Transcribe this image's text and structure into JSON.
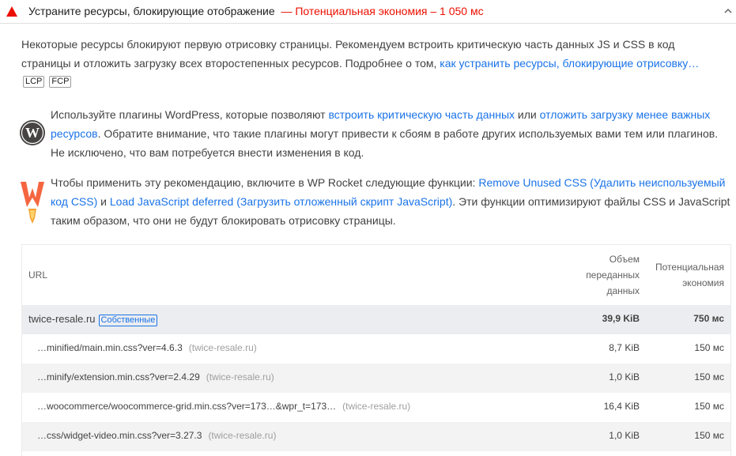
{
  "audit": {
    "title": "Устраните ресурсы, блокирующие отображение",
    "savings": "— Потенциальная экономия – 1 050 мс",
    "icon_warn": "warning-triangle-icon",
    "icon_toggle": "chevron-up-icon",
    "warn_color": "#eb0f00"
  },
  "description": {
    "text": "Некоторые ресурсы блокируют первую отрисовку страницы. Рекомендуем встроить критическую часть данных JS и CSS в код страницы и отложить загрузку всех второстепенных ресурсов. Подробнее о том, ",
    "link": "как устранить ресурсы, блокирующие отрисовку…",
    "badges": [
      "LCP",
      "FCP"
    ]
  },
  "wordpress": {
    "icon": "wordpress-logo-icon",
    "text1": "Используйте плагины WordPress, которые позволяют ",
    "link1": "встроить критическую часть данных",
    "text2": " или ",
    "link2": "отложить загрузку менее важных ресурсов",
    "text3": ". Обратите внимание, что такие плагины могут привести к сбоям в работе других используемых вами тем или плагинов. Не исключено, что вам потребуется внести изменения в код."
  },
  "wprocket": {
    "icon": "wp-rocket-logo-icon",
    "text1": "Чтобы применить эту рекомендацию, включите в WP Rocket следующие функции: ",
    "link1": "Remove Unused CSS (Удалить неиспользуемый код CSS)",
    "text2": " и ",
    "link2": "Load JavaScript deferred (Загрузить отложенный скрипт JavaScript)",
    "text3": ". Эти функции оптимизируют файлы CSS и JavaScript таким образом, что они не будут блокировать отрисовку страницы."
  },
  "table": {
    "headers": {
      "url": "URL",
      "size_line1": "Объем",
      "size_line2": "переданных",
      "size_line3": "данных",
      "wasted_line1": "Потенциальная",
      "wasted_line2": "экономия"
    },
    "group": {
      "host": "twice-resale.ru",
      "badge": "Собственные",
      "size": "39,9 KiB",
      "wasted": "750 мс"
    },
    "rows": [
      {
        "url": "…minified/main.min.css?ver=4.6.3",
        "host": "(twice-resale.ru)",
        "size": "8,7 KiB",
        "wasted": "150 мс"
      },
      {
        "url": "…minify/extension.min.css?ver=2.4.29",
        "host": "(twice-resale.ru)",
        "size": "1,0 KiB",
        "wasted": "150 мс"
      },
      {
        "url": "…woocommerce/woocommerce-grid.min.css?ver=173…&wpr_t=173…",
        "host": "(twice-resale.ru)",
        "size": "16,4 KiB",
        "wasted": "150 мс"
      },
      {
        "url": "…css/widget-video.min.css?ver=3.27.3",
        "host": "(twice-resale.ru)",
        "size": "1,0 KiB",
        "wasted": "150 мс"
      }
    ]
  }
}
